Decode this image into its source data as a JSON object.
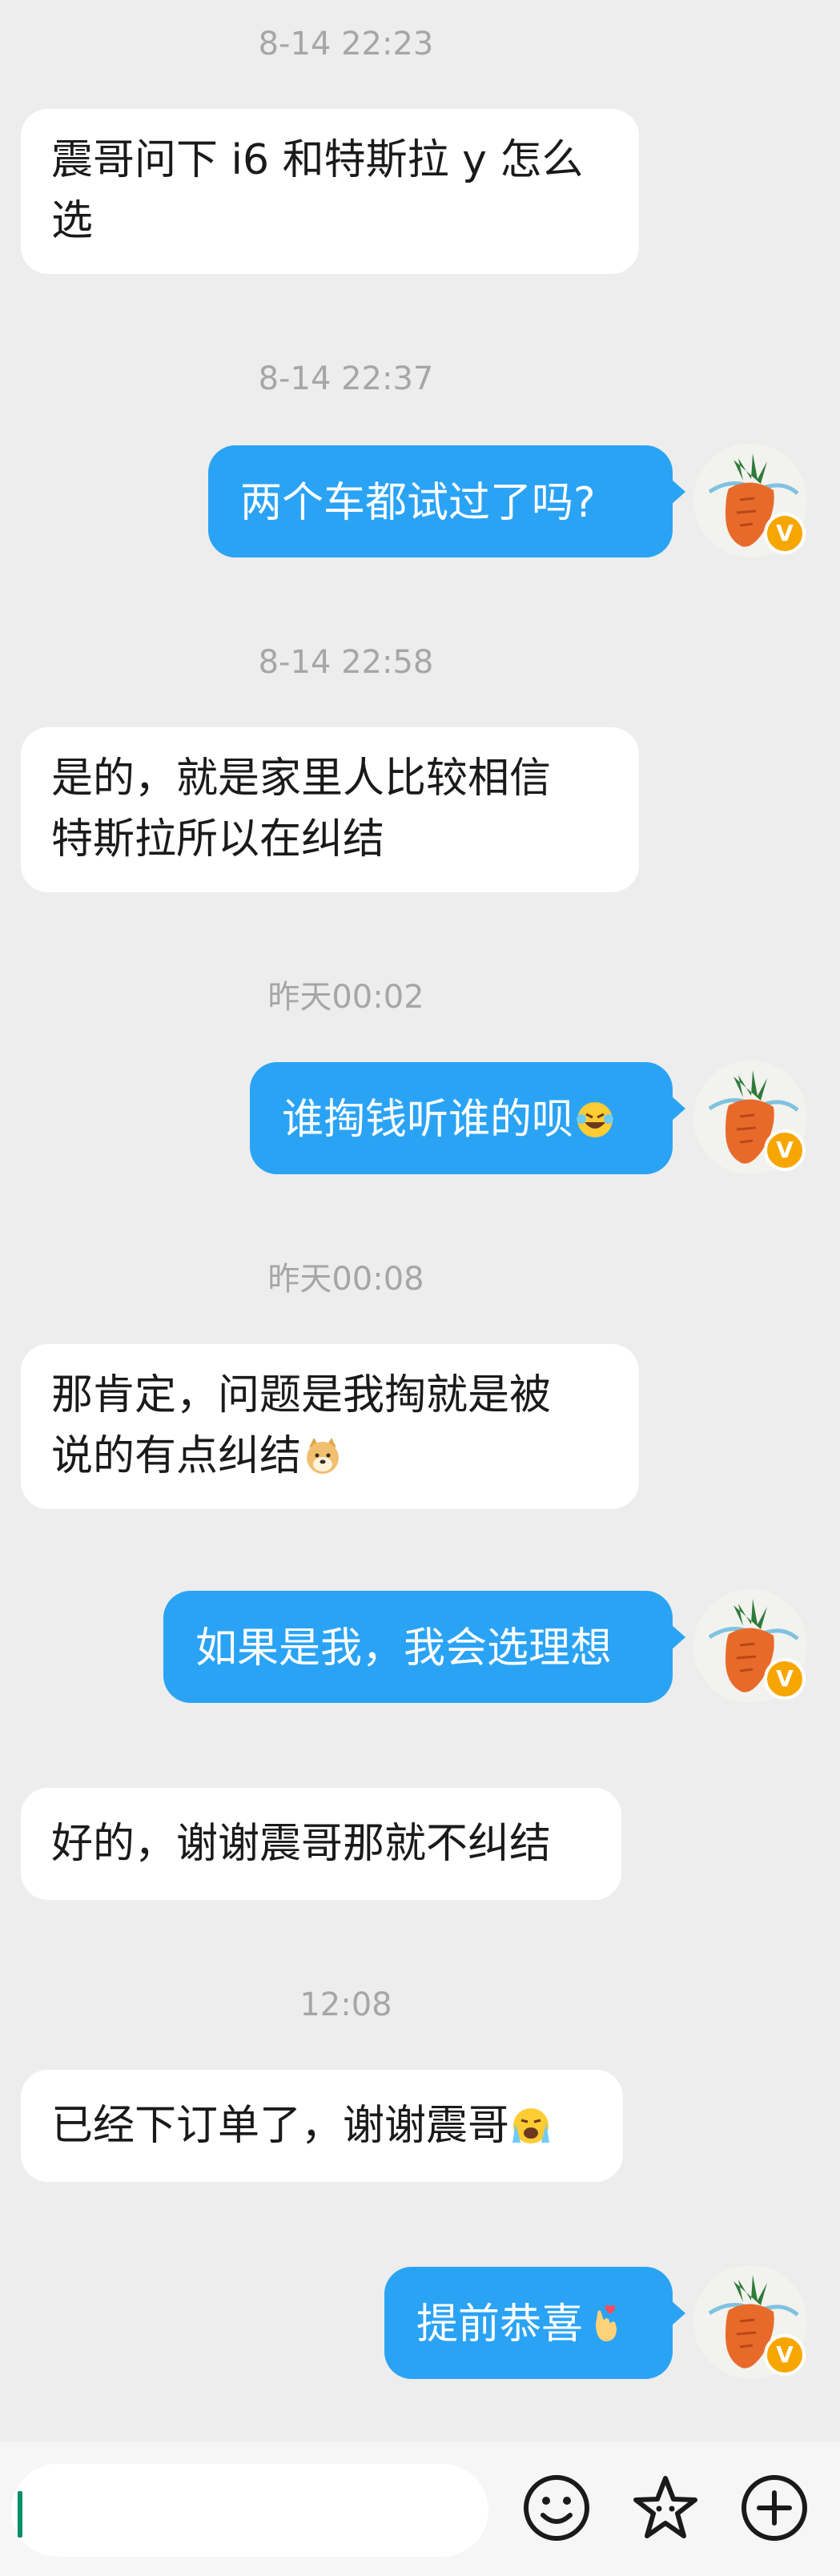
{
  "conversation": {
    "timestamps": {
      "t1": "8-14 22:23",
      "t2": "8-14 22:37",
      "t3": "8-14 22:58",
      "t4": "昨天00:02",
      "t5": "昨天00:08",
      "t6": "12:08"
    },
    "messages": {
      "m1_line1": "震哥问下 i6 和特斯拉 y 怎么",
      "m1_line2": "选",
      "m2": "两个车都试过了吗?",
      "m3_line1": "是的，就是家里人比较相信",
      "m3_line2": "特斯拉所以在纠结",
      "m4": "谁掏钱听谁的呗",
      "m5_line1": "那肯定，问题是我掏就是被",
      "m5_line2": "说的有点纠结",
      "m6": "如果是我，我会选理想",
      "m7": "好的，谢谢震哥那就不纠结",
      "m8": "已经下订单了，谢谢震哥",
      "m9": "提前恭喜"
    },
    "emojis": {
      "m4": "laughing-tears-emoji",
      "m5": "doge-emoji",
      "m8": "crying-emoji",
      "m9": "finger-heart-emoji"
    }
  },
  "avatar": {
    "description_icon": "carrot-avatar",
    "badge": "V",
    "badge_color": "#f7a600"
  },
  "input_bar": {
    "value": "",
    "icons": [
      "smiley-face-icon",
      "star-sticker-icon",
      "plus-circle-icon"
    ]
  },
  "colors": {
    "background": "#ededed",
    "outgoing_bubble": "#2aa3f5",
    "incoming_bubble": "#ffffff",
    "timestamp": "#a6a6a6",
    "caret": "#0a8f6a"
  }
}
